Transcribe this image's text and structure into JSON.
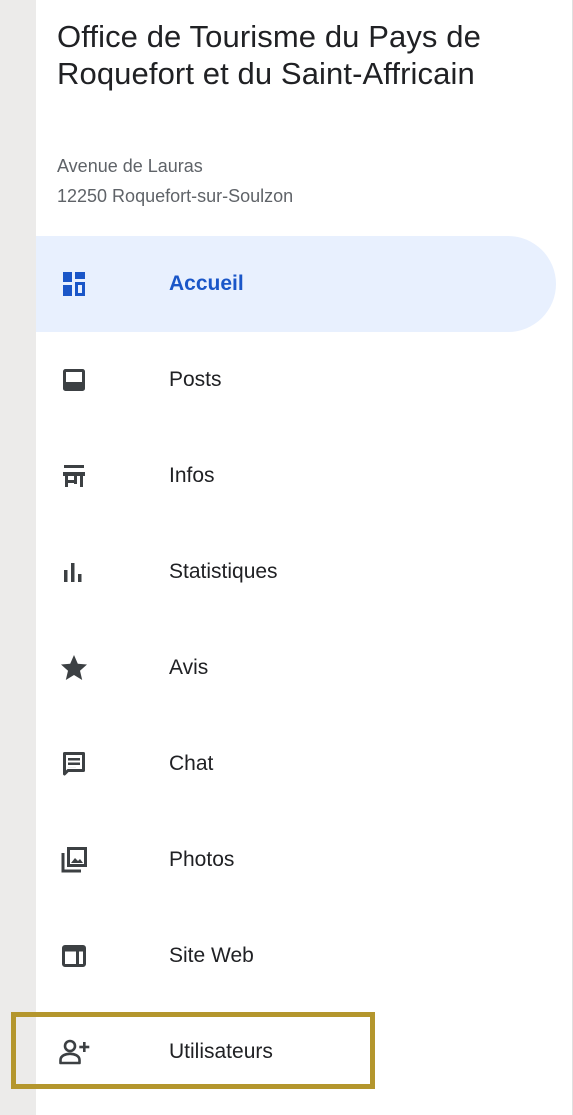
{
  "business": {
    "name": "Office de Tourisme du Pays de Roquefort et du Saint-Affricain",
    "address_line1": "Avenue de Lauras",
    "address_line2": "12250 Roquefort-sur-Soulzon"
  },
  "colors": {
    "active_bg": "#e8f0fe",
    "active_text": "#1a56c8",
    "icon": "#3c4043",
    "highlight_border": "#b4962d"
  },
  "nav": {
    "items": [
      {
        "label": "Accueil",
        "icon": "dashboard-icon",
        "active": true
      },
      {
        "label": "Posts",
        "icon": "post-icon",
        "active": false
      },
      {
        "label": "Infos",
        "icon": "storefront-icon",
        "active": false
      },
      {
        "label": "Statistiques",
        "icon": "bar-chart-icon",
        "active": false
      },
      {
        "label": "Avis",
        "icon": "star-icon",
        "active": false
      },
      {
        "label": "Chat",
        "icon": "chat-icon",
        "active": false
      },
      {
        "label": "Photos",
        "icon": "photos-icon",
        "active": false
      },
      {
        "label": "Site Web",
        "icon": "website-icon",
        "active": false
      },
      {
        "label": "Utilisateurs",
        "icon": "add-user-icon",
        "active": false
      }
    ]
  }
}
